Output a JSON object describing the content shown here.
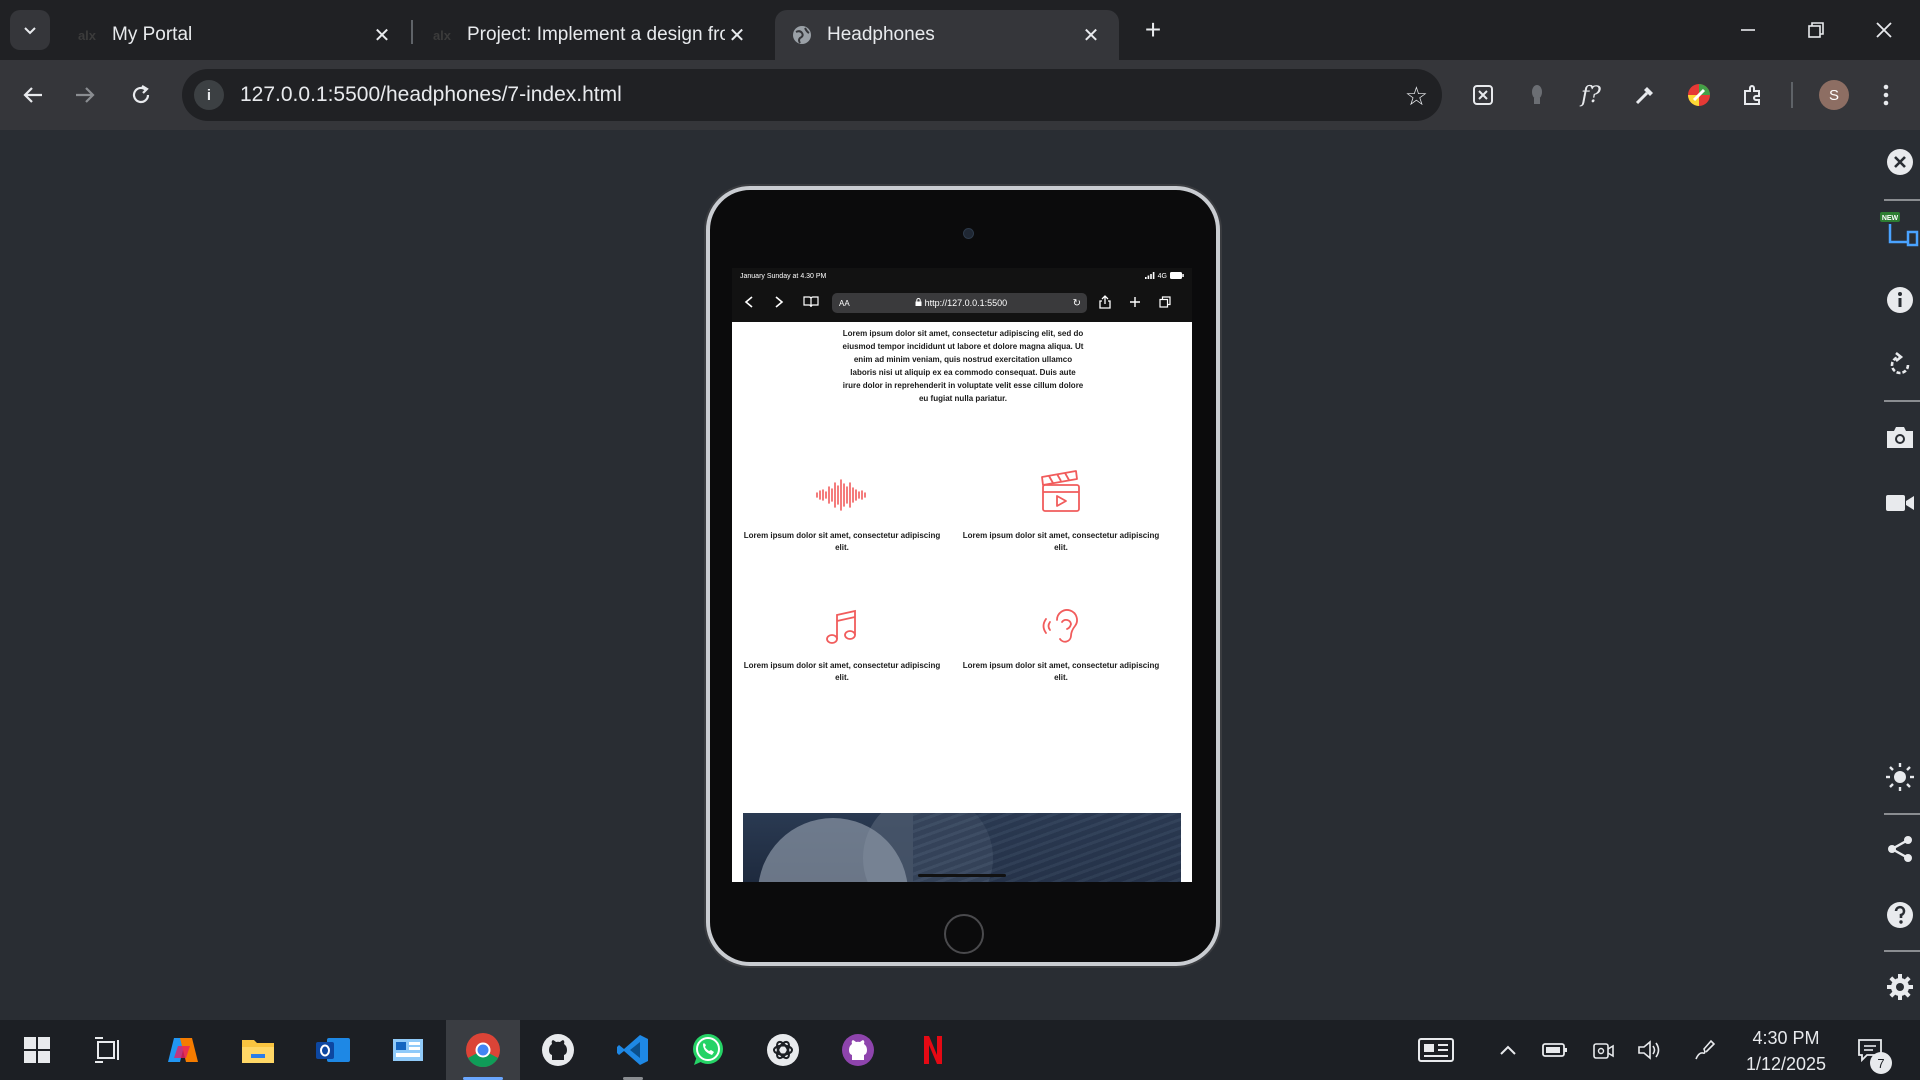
{
  "tabs": [
    {
      "title": "My Portal",
      "favicon_text": "alx"
    },
    {
      "title": "Project: Implement a design fro",
      "favicon_text": "alx"
    },
    {
      "title": "Headphones",
      "favicon": "globe-icon"
    }
  ],
  "address_bar": {
    "url": "127.0.0.1:5500/headphones/7-index.html"
  },
  "profile": {
    "initial": "S"
  },
  "devtools_panel": {
    "new_badge": "NEW"
  },
  "device": {
    "status_time": "January Sunday at 4.30 PM",
    "status_signal": "4G",
    "url": "http://127.0.0.1:5500",
    "text_size_label": "AA"
  },
  "page": {
    "intro_text": "Lorem ipsum dolor sit amet, consectetur adipiscing elit, sed do eiusmod tempor incididunt ut labore et dolore magna aliqua. Ut enim ad minim veniam, quis nostrud exercitation ullamco laboris nisi ut aliquip ex ea commodo consequat. Duis aute irure dolor in reprehenderit in voluptate velit esse cillum dolore eu fugiat nulla pariatur.",
    "features": [
      {
        "icon": "soundwave-icon",
        "text": "Lorem ipsum dolor sit amet, consectetur adipiscing elit."
      },
      {
        "icon": "clapperboard-icon",
        "text": "Lorem ipsum dolor sit amet, consectetur adipiscing elit."
      },
      {
        "icon": "music-note-icon",
        "text": "Lorem ipsum dolor sit amet, consectetur adipiscing elit."
      },
      {
        "icon": "ear-icon",
        "text": "Lorem ipsum dolor sit amet, consectetur adipiscing elit."
      }
    ],
    "accent_color": "#f15c5c"
  },
  "taskbar": {
    "clock_time": "4:30 PM",
    "clock_date": "1/12/2025",
    "notification_count": "7"
  }
}
